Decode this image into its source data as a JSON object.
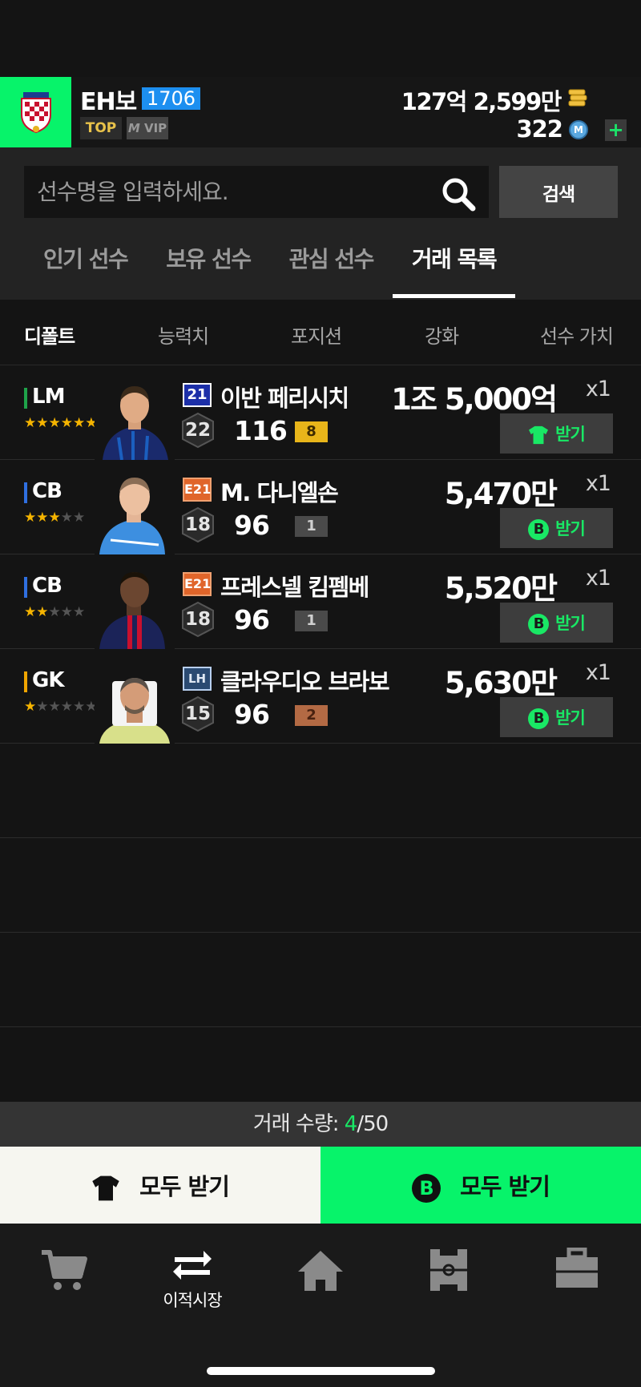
{
  "header": {
    "username": "EH보",
    "level": "1706",
    "badge_top": "TOP",
    "badge_vip": "VIP",
    "money": "127억 2,599만",
    "points": "322",
    "plus": "+"
  },
  "search": {
    "placeholder": "선수명을 입력하세요.",
    "button": "검색"
  },
  "tabs": [
    "인기 선수",
    "보유 선수",
    "관심 선수",
    "거래 목록"
  ],
  "sort": [
    "디폴트",
    "능력치",
    "포지션",
    "강화",
    "선수 가치"
  ],
  "rows": [
    {
      "position": "LM",
      "pos_color": "#1fa34a",
      "stars_on": 6,
      "stars_total": 6,
      "season": "21",
      "name": "이반 페리시치",
      "ovr": "22",
      "stat": "116",
      "grade": "8",
      "price": "1조 5,000억",
      "qty": "x1",
      "btn": "받기",
      "btn_icon": "shirt-icon"
    },
    {
      "position": "CB",
      "pos_color": "#2f6fe0",
      "stars_on": 3,
      "stars_total": 5,
      "season": "E21",
      "name": "M. 다니엘손",
      "ovr": "18",
      "stat": "96",
      "grade": "1",
      "price": "5,470만",
      "qty": "x1",
      "btn": "받기",
      "btn_icon": "b-coin-icon"
    },
    {
      "position": "CB",
      "pos_color": "#2f6fe0",
      "stars_on": 2,
      "stars_total": 5,
      "season": "E21",
      "name": "프레스넬 킴펨베",
      "ovr": "18",
      "stat": "96",
      "grade": "1",
      "price": "5,520만",
      "qty": "x1",
      "btn": "받기",
      "btn_icon": "b-coin-icon"
    },
    {
      "position": "GK",
      "pos_color": "#f0a500",
      "stars_on": 1,
      "stars_total": 6,
      "season": "LH",
      "name": "클라우디오 브라보",
      "ovr": "15",
      "stat": "96",
      "grade": "2",
      "price": "5,630만",
      "qty": "x1",
      "btn": "받기",
      "btn_icon": "b-coin-icon"
    }
  ],
  "trade": {
    "label": "거래 수량: ",
    "current": "4",
    "max": "/50"
  },
  "claim": {
    "left": "모두 받기",
    "right": "모두 받기",
    "coin_letter": "B"
  },
  "nav": {
    "transfer_label": "이적시장"
  }
}
